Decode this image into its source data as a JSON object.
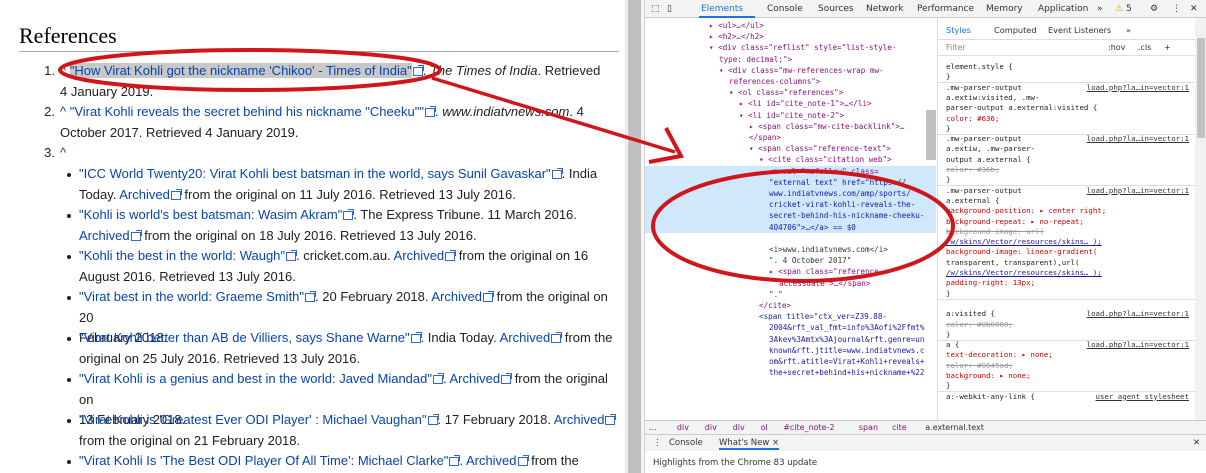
{
  "wiki": {
    "heading": "References",
    "refs": [
      {
        "num": "1.",
        "caret": "^",
        "title": "\"How Virat Kohli got the nickname 'Chikoo' - Times of India\"",
        "after1": ". ",
        "pub": "The Times of India",
        "after2": ". Retrieved",
        "line2": "4 January 2019."
      },
      {
        "num": "2.",
        "caret": "^",
        "title": "\"Virat Kohli reveals the secret behind his nickname \"Cheeku\"\"",
        "after1": ". ",
        "pub": "www.indiatvnews.com",
        "after2": ". 4",
        "line2": "October 2017. Retrieved 4 January 2019."
      },
      {
        "num": "3.",
        "caret": "^"
      }
    ],
    "bullets": [
      {
        "l1a": "\"ICC World Twenty20: Virat Kohli best batsman in the world, says Sunil Gavaskar\"",
        "l1b": ". India",
        "l2a": "Today. ",
        "l2link": "Archived",
        "l2b": " from the original on 11 July 2016. Retrieved 13 July 2016."
      },
      {
        "l1a": "\"Kohli is world's best batsman: Wasim Akram\"",
        "l1b": ". The Express Tribune. 11 March 2016.",
        "l2a": "",
        "l2link": "Archived",
        "l2b": " from the original on 18 July 2016. Retrieved 13 July 2016."
      },
      {
        "l1a": "\"Kohli the best in the world: Waugh\"",
        "l1b": ". cricket.com.au. ",
        "l1link": "Archived",
        "l1c": " from the original on 16",
        "l2a": "August 2016. Retrieved 13 July 2016.",
        "l2link": "",
        "l2b": ""
      },
      {
        "l1a": "\"Virat best in the world: Graeme Smith\"",
        "l1b": ". 20 February 2018. ",
        "l1link": "Archived",
        "l1c": " from the original on 20",
        "l2a": "February 2018.",
        "l2link": "",
        "l2b": ""
      },
      {
        "l1a": "\"Virat Kohli better than AB de Villiers, says Shane Warne\"",
        "l1b": ". India Today. ",
        "l1link": "Archived",
        "l1c": " from the",
        "l2a": "original on 25 July 2016. Retrieved 13 July 2016.",
        "l2link": "",
        "l2b": ""
      },
      {
        "l1a": "\"Virat Kohli is a genius and best in the world: Javed Miandad\"",
        "l1b": ". ",
        "l1link": "Archived",
        "l1c": " from the original on",
        "l2a": "13 February 2018.",
        "l2link": "",
        "l2b": ""
      },
      {
        "l1a": "\"Virat Kohli is 'Greatest Ever ODI Player' : Michael Vaughan\"",
        "l1b": ". 17 February 2018. ",
        "l1link": "Archived",
        "l1c": "",
        "l2a": "from the original on 21 February 2018.",
        "l2link": "",
        "l2b": ""
      },
      {
        "l1a": "\"Virat Kohli Is 'The Best ODI Player Of All Time': Michael Clarke\"",
        "l1b": ". ",
        "l1link": "Archived",
        "l1c": " from the original",
        "l2a": "",
        "l2link": "",
        "l2b": ""
      }
    ]
  },
  "devtools": {
    "tabs": [
      "Elements",
      "Console",
      "Sources",
      "Network",
      "Performance",
      "Memory",
      "Application"
    ],
    "warn_count": "5",
    "elements": [
      "▸ <ul>…</ul>",
      "▸ <h2>…</h2>",
      "▾ <div class=\"reflist\" style=\"list-style-",
      "type: decimal;\">",
      "▾ <div class=\"mw-references-wrap mw-",
      "references-columns\">",
      "▾ <ol class=\"references\">",
      "▸ <li id=\"cite_note-1\">…</li>",
      "▾ <li id=\"cite_note-2\">",
      "▸ <span class=\"mw-cite-backlink\">…",
      "</span>",
      "▾ <span class=\"reference-text\">",
      "▾ <cite class=\"citation web\">",
      "<a rel=\"nofollow\" class=",
      "\"external text\" href=\"https://",
      "www.indiatvnews.com/amp/sports/",
      "cricket-virat-kohli-reveals-the-",
      "secret-behind-his-nickname-cheeku-",
      "404706\">…</a> == $0",
      "",
      "<i>www.indiatvnews.com</i>",
      "\". 4 October 2017\"",
      "▸ <span class=\"reference-",
      "accessdate\">…</span>",
      "\".\"",
      "</cite>",
      "<span title=\"ctx_ver=Z39.88-",
      "2004&rft_val_fmt=info%3Aofi%2Ffmt%",
      "3Akev%3Amtx%3Ajournal&rft.genre=un",
      "known&rft.jtitle=www.indiatvnews.c",
      "om&rft.atitle=Virat+Kohli+reveals+",
      "the+secret+behind+his+nickname+%22"
    ],
    "styles_tabs": [
      "Styles",
      "Computed",
      "Event Listeners",
      "»"
    ],
    "filter_placeholder": "Filter",
    "filter_opts": [
      ":hov",
      ".cls",
      "+"
    ],
    "style_lines": [
      {
        "t": "element.style {",
        "k": "sel"
      },
      {
        "t": "}",
        "k": "sel"
      },
      {
        "t": ".mw-parser-output",
        "k": "sel",
        "src": "load.php?la…in=vector:1"
      },
      {
        "t": "a.extiw:visited, .mw-",
        "k": "sel"
      },
      {
        "t": "parser-output a.external:visited {",
        "k": "sel"
      },
      {
        "t": "  color: #636;",
        "k": "prop"
      },
      {
        "t": "}",
        "k": "sel"
      },
      {
        "t": ".mw-parser-output",
        "k": "sel",
        "src": "load.php?la…in=vector:1"
      },
      {
        "t": "a.extiw, .mw-parser-",
        "k": "sel"
      },
      {
        "t": "output a.external {",
        "k": "sel"
      },
      {
        "t": "  color: #36b;",
        "k": "strike"
      },
      {
        "t": "}",
        "k": "sel"
      },
      {
        "t": ".mw-parser-output",
        "k": "sel",
        "src": "load.php?la…in=vector:1"
      },
      {
        "t": "a.external {",
        "k": "sel"
      },
      {
        "t": "  background-position: ▸ center right;",
        "k": "prop"
      },
      {
        "t": "  background-repeat: ▸ no-repeat;",
        "k": "prop"
      },
      {
        "t": "  background-image: url(",
        "k": "strike"
      },
      {
        "t": "     /w/skins/Vector/resources/skins… );",
        "k": "link"
      },
      {
        "t": "  background-image: linear-gradient(",
        "k": "prop"
      },
      {
        "t": "     transparent, transparent),url(",
        "k": "val"
      },
      {
        "t": "     /w/skins/Vector/resources/skins… );",
        "k": "link"
      },
      {
        "t": "  padding-right: 13px;",
        "k": "prop"
      },
      {
        "t": "}",
        "k": "sel"
      },
      {
        "t": "",
        "k": "sel"
      },
      {
        "t": "a:visited {",
        "k": "sel",
        "src": "load.php?la…in=vector:1"
      },
      {
        "t": "  color: #0b0080;",
        "k": "strike"
      },
      {
        "t": "}",
        "k": "sel"
      },
      {
        "t": "a {",
        "k": "sel",
        "src": "load.php?la…in=vector:1"
      },
      {
        "t": "  text-decoration: ▸ none;",
        "k": "prop"
      },
      {
        "t": "  color: #0645ad;",
        "k": "strike"
      },
      {
        "t": "  background: ▸ none;",
        "k": "prop"
      },
      {
        "t": "}",
        "k": "sel"
      },
      {
        "t": "a:-webkit-any-link {",
        "k": "sel",
        "src": "user agent stylesheet"
      }
    ],
    "breadcrumb": [
      "...",
      "div",
      "div",
      "div",
      "ol",
      "#cite_note-2",
      "span",
      "cite",
      "a.external.text"
    ],
    "drawer_tabs": [
      "Console",
      "What's New ×"
    ],
    "drawer_message": "Highlights from the Chrome 83 update"
  },
  "colors": {
    "link": "#0645ad",
    "annotation": "#d0161b",
    "selected": "#cfe8fc"
  }
}
